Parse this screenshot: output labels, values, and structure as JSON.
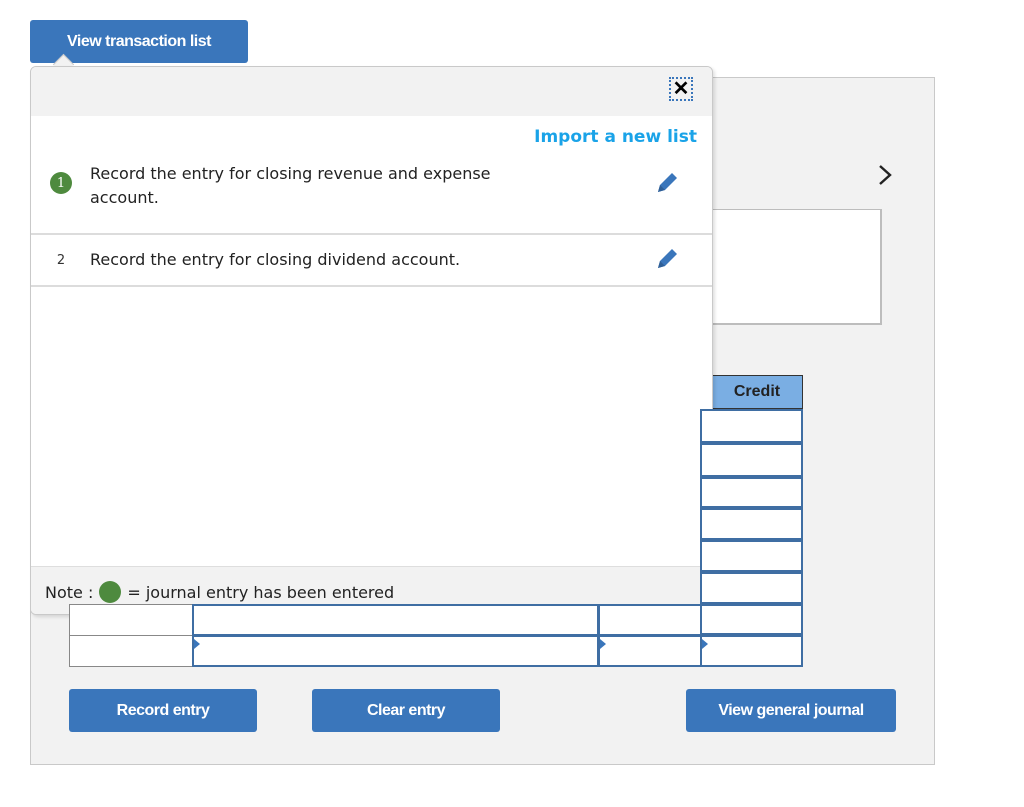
{
  "toolbar": {
    "view_transaction_list_label": "View transaction list"
  },
  "popover": {
    "close_label": "✕",
    "import_link_label": "Import a new list",
    "transactions": [
      {
        "number": "1",
        "completed": true,
        "text": "Record the entry for closing revenue and expense account."
      },
      {
        "number": "2",
        "completed": false,
        "text": "Record the entry for closing dividend account."
      }
    ],
    "note": {
      "prefix": "Note :",
      "suffix": "= journal entry has been entered"
    }
  },
  "main": {
    "next_arrow_label": "›",
    "table": {
      "credit_header": "Credit"
    },
    "buttons": {
      "record_entry": "Record entry",
      "clear_entry": "Clear entry",
      "view_general_journal": "View general journal"
    }
  },
  "colors": {
    "primary_button": "#3a76bb",
    "link": "#1aa3e8",
    "completed_badge": "#4e8a3e",
    "table_header": "#7aaee3",
    "panel_background": "#f2f2f2"
  }
}
